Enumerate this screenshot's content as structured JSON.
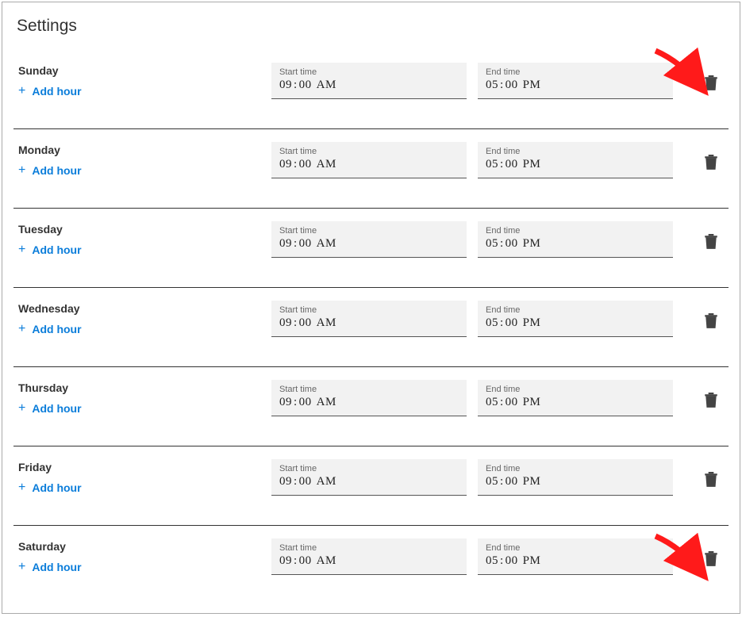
{
  "page_title": "Settings",
  "add_hour_label": "Add hour",
  "start_label": "Start time",
  "end_label": "End time",
  "days": [
    {
      "name": "Sunday",
      "start_h": "09",
      "start_m": "00",
      "start_ampm": "AM",
      "end_h": "05",
      "end_m": "00",
      "end_ampm": "PM"
    },
    {
      "name": "Monday",
      "start_h": "09",
      "start_m": "00",
      "start_ampm": "AM",
      "end_h": "05",
      "end_m": "00",
      "end_ampm": "PM"
    },
    {
      "name": "Tuesday",
      "start_h": "09",
      "start_m": "00",
      "start_ampm": "AM",
      "end_h": "05",
      "end_m": "00",
      "end_ampm": "PM"
    },
    {
      "name": "Wednesday",
      "start_h": "09",
      "start_m": "00",
      "start_ampm": "AM",
      "end_h": "05",
      "end_m": "00",
      "end_ampm": "PM"
    },
    {
      "name": "Thursday",
      "start_h": "09",
      "start_m": "00",
      "start_ampm": "AM",
      "end_h": "05",
      "end_m": "00",
      "end_ampm": "PM"
    },
    {
      "name": "Friday",
      "start_h": "09",
      "start_m": "00",
      "start_ampm": "AM",
      "end_h": "05",
      "end_m": "00",
      "end_ampm": "PM"
    },
    {
      "name": "Saturday",
      "start_h": "09",
      "start_m": "00",
      "start_ampm": "AM",
      "end_h": "05",
      "end_m": "00",
      "end_ampm": "PM"
    }
  ],
  "annotations": {
    "arrows": [
      {
        "target": "delete-button-row-0"
      },
      {
        "target": "delete-button-row-6"
      }
    ]
  }
}
